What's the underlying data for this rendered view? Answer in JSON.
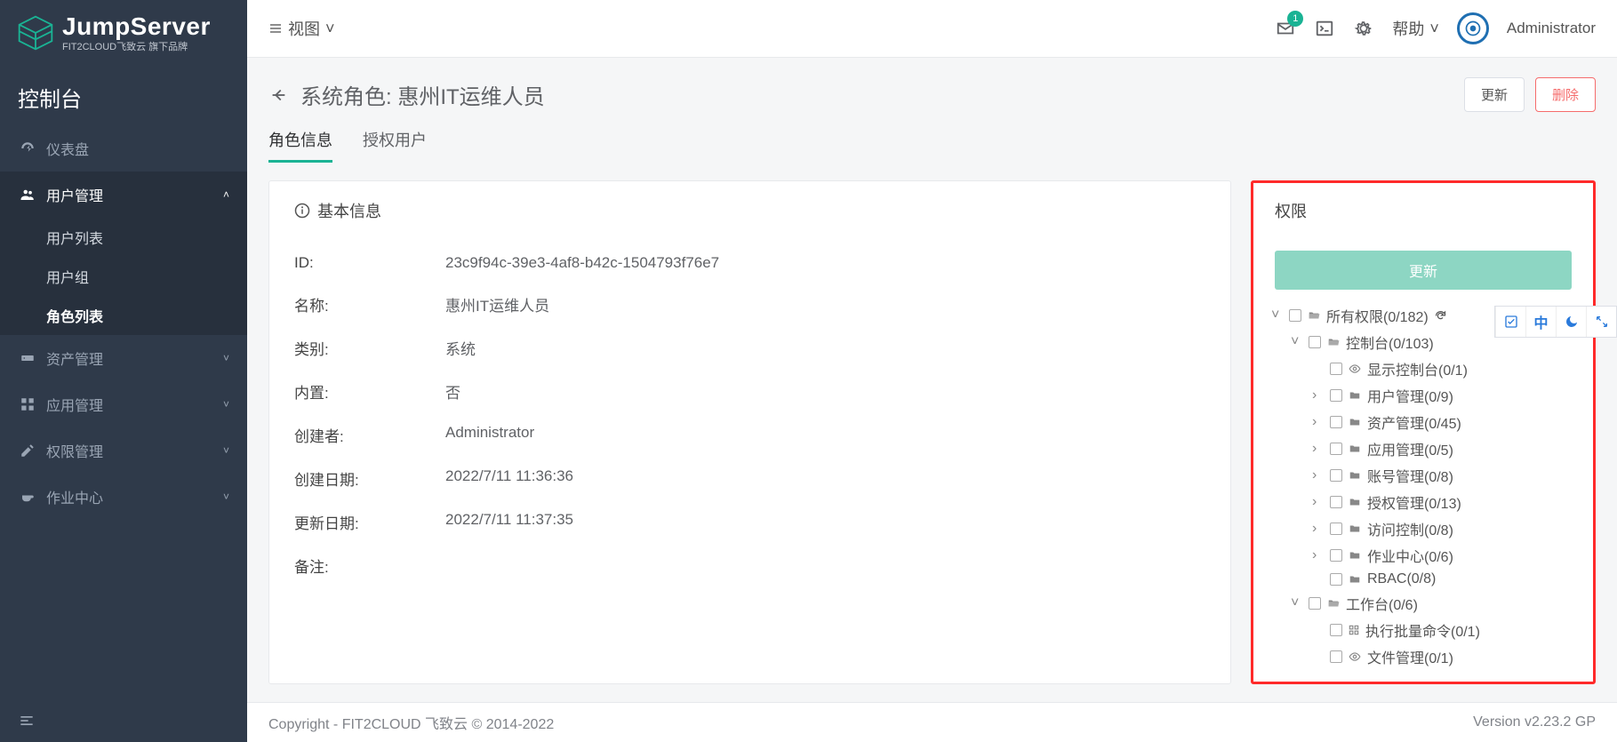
{
  "logo": {
    "brand": "JumpServer",
    "tagline": "FIT2CLOUD飞致云 旗下品牌"
  },
  "sidebar": {
    "section": "控制台",
    "items": [
      {
        "label": "仪表盘"
      },
      {
        "label": "用户管理"
      },
      {
        "label": "资产管理"
      },
      {
        "label": "应用管理"
      },
      {
        "label": "权限管理"
      },
      {
        "label": "作业中心"
      }
    ],
    "user_mgmt_sub": [
      {
        "label": "用户列表"
      },
      {
        "label": "用户组"
      },
      {
        "label": "角色列表"
      }
    ]
  },
  "topbar": {
    "view_label": "视图",
    "badge": "1",
    "help": "帮助",
    "user": "Administrator"
  },
  "page": {
    "title": "系统角色: 惠州IT运维人员",
    "update_btn": "更新",
    "delete_btn": "删除"
  },
  "tabs": [
    {
      "label": "角色信息"
    },
    {
      "label": "授权用户"
    }
  ],
  "basic_info": {
    "title": "基本信息",
    "rows": {
      "id_label": "ID:",
      "id_value": "23c9f94c-39e3-4af8-b42c-1504793f76e7",
      "name_label": "名称:",
      "name_value": "惠州IT运维人员",
      "type_label": "类别:",
      "type_value": "系统",
      "builtin_label": "内置:",
      "builtin_value": "否",
      "creator_label": "创建者:",
      "creator_value": "Administrator",
      "created_label": "创建日期:",
      "created_value": "2022/7/11 11:36:36",
      "updated_label": "更新日期:",
      "updated_value": "2022/7/11 11:37:35",
      "remark_label": "备注:",
      "remark_value": ""
    }
  },
  "perm": {
    "title": "权限",
    "update_btn": "更新",
    "tree": [
      {
        "indent": 0,
        "caret": "down",
        "folder": "open",
        "label": "所有权限(0/182)",
        "refresh": true
      },
      {
        "indent": 1,
        "caret": "down",
        "folder": "open",
        "label": "控制台(0/103)"
      },
      {
        "indent": 2,
        "caret": "",
        "icon": "eye",
        "label": "显示控制台(0/1)"
      },
      {
        "indent": 2,
        "caret": "right",
        "folder": "closed",
        "label": "用户管理(0/9)"
      },
      {
        "indent": 2,
        "caret": "right",
        "folder": "closed",
        "label": "资产管理(0/45)"
      },
      {
        "indent": 2,
        "caret": "right",
        "folder": "closed",
        "label": "应用管理(0/5)"
      },
      {
        "indent": 2,
        "caret": "right",
        "folder": "closed",
        "label": "账号管理(0/8)"
      },
      {
        "indent": 2,
        "caret": "right",
        "folder": "closed",
        "label": "授权管理(0/13)"
      },
      {
        "indent": 2,
        "caret": "right",
        "folder": "closed",
        "label": "访问控制(0/8)"
      },
      {
        "indent": 2,
        "caret": "right",
        "folder": "closed",
        "label": "作业中心(0/6)"
      },
      {
        "indent": 2,
        "caret": "",
        "folder": "closed",
        "label": "RBAC(0/8)"
      },
      {
        "indent": 1,
        "caret": "down",
        "folder": "open",
        "label": "工作台(0/6)"
      },
      {
        "indent": 2,
        "caret": "",
        "icon": "grid",
        "label": "执行批量命令(0/1)"
      },
      {
        "indent": 2,
        "caret": "",
        "icon": "eye",
        "label": "文件管理(0/1)"
      }
    ]
  },
  "footer": {
    "copyright": "Copyright - FIT2CLOUD 飞致云 © 2014-2022",
    "version": "Version v2.23.2 GP"
  },
  "widgets": {
    "lang": "中"
  }
}
